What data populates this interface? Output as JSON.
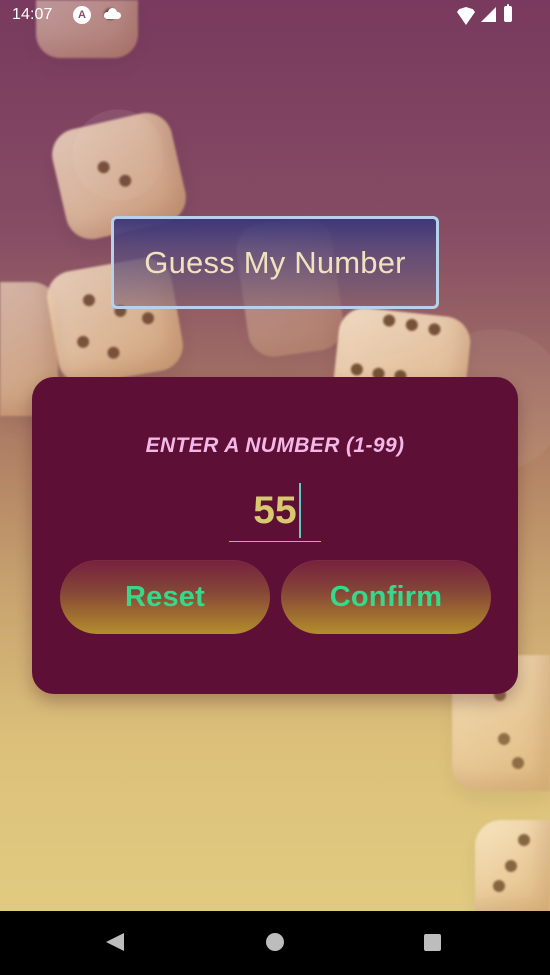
{
  "status_bar": {
    "time": "14:07",
    "app_letter": "A"
  },
  "header": {
    "title": "Guess My Number"
  },
  "card": {
    "prompt": "ENTER A NUMBER (1-99)",
    "input_value": "55"
  },
  "buttons": {
    "reset": "Reset",
    "confirm": "Confirm"
  },
  "icons": {
    "status_cloud": "cloud-icon",
    "status_wifi": "wifi-icon",
    "status_signal": "signal-icon",
    "status_battery": "battery-icon",
    "nav_back": "back-icon",
    "nav_home": "home-icon",
    "nav_recent": "recent-apps-icon"
  },
  "colors": {
    "card_background": "#5d0f35",
    "title_border": "#b6d1ea",
    "prompt_text": "#f2b8e7",
    "input_text": "#d8c96e",
    "button_text": "#34d98b"
  }
}
